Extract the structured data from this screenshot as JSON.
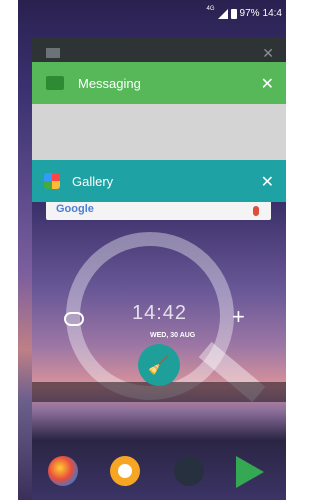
{
  "status_bar": {
    "network": "4G",
    "battery": "97%",
    "time": "14:4"
  },
  "recent_apps": [
    {
      "title": "Messaging",
      "close": "✕"
    },
    {
      "title": "Gallery",
      "close": "✕"
    }
  ],
  "preview": {
    "search_logo": "Google",
    "clock_time": "14:42",
    "clock_date": "WED, 30 AUG"
  },
  "icons": {
    "clean_all": "broom-icon",
    "add": "+"
  },
  "colors": {
    "messaging_header": "#57b85a",
    "gallery_header": "#1fa2a3",
    "clean_button": "#1f9f9a"
  }
}
